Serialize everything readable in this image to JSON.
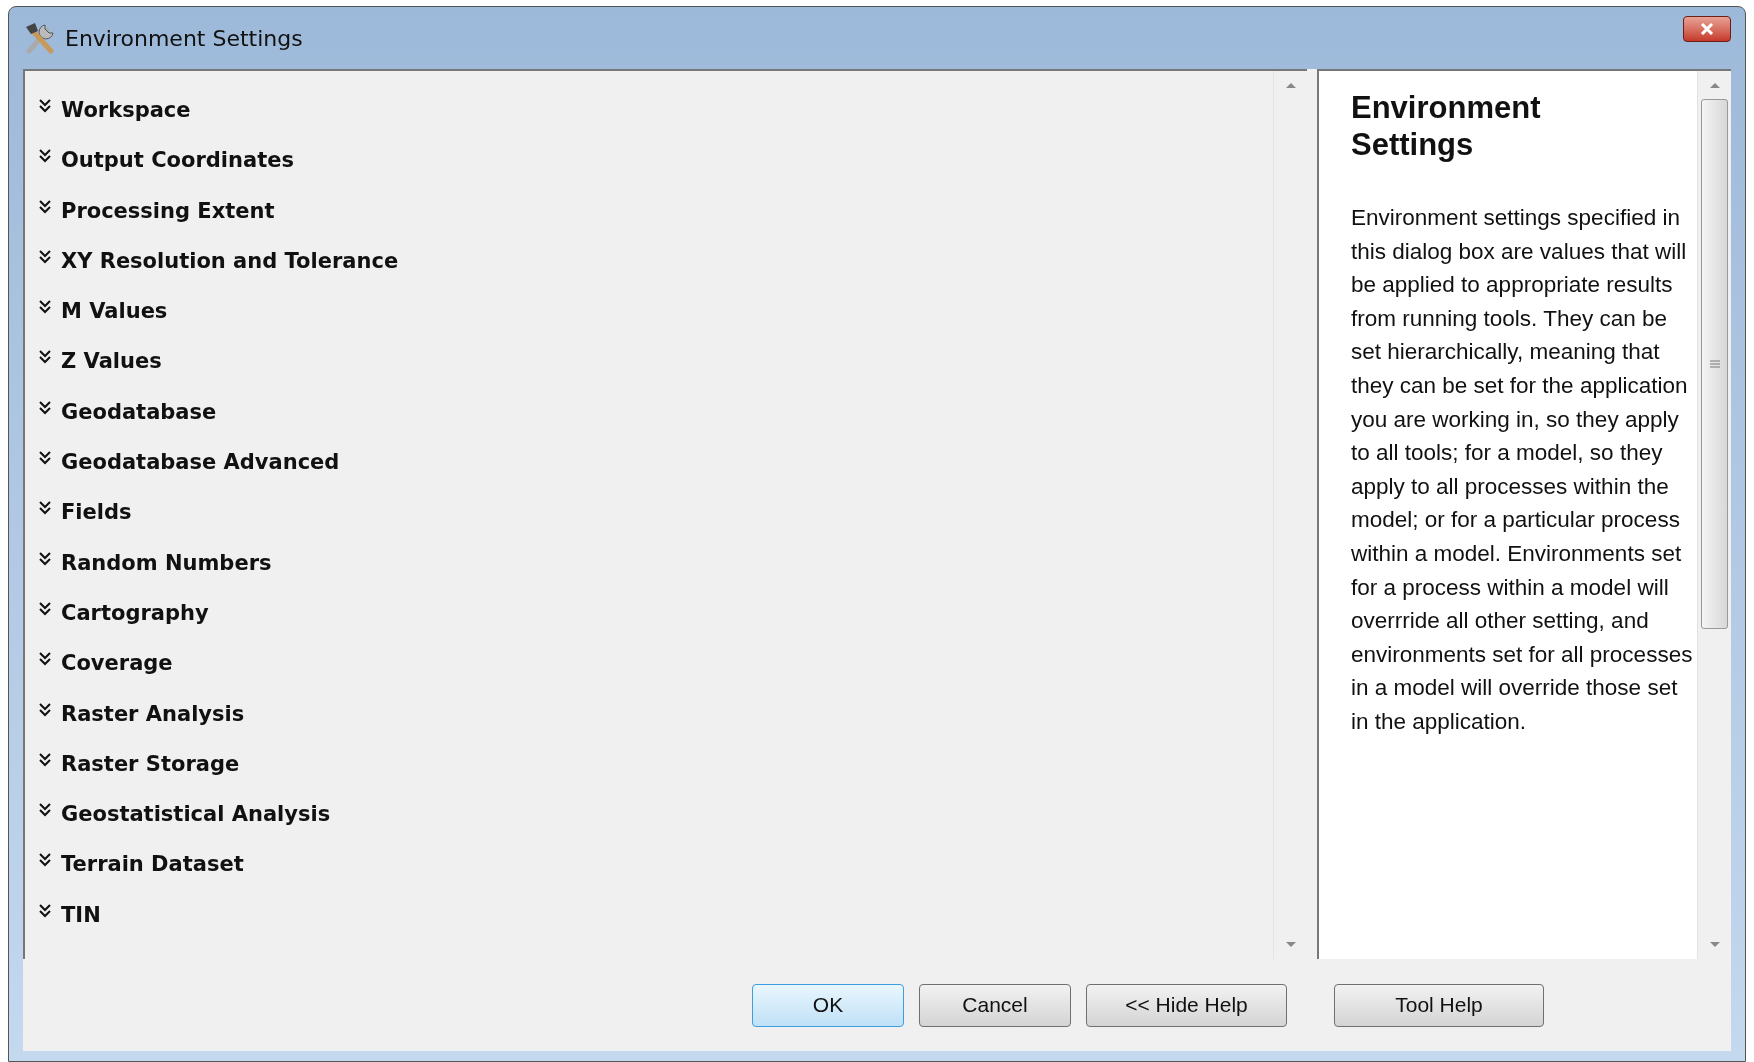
{
  "window": {
    "title": "Environment Settings"
  },
  "sections": [
    {
      "label": "Workspace",
      "expanded": false
    },
    {
      "label": "Output Coordinates",
      "expanded": false
    },
    {
      "label": "Processing Extent",
      "expanded": false
    },
    {
      "label": "XY Resolution and Tolerance",
      "expanded": false
    },
    {
      "label": "M Values",
      "expanded": false
    },
    {
      "label": "Z Values",
      "expanded": false
    },
    {
      "label": "Geodatabase",
      "expanded": false
    },
    {
      "label": "Geodatabase Advanced",
      "expanded": false
    },
    {
      "label": "Fields",
      "expanded": false
    },
    {
      "label": "Random Numbers",
      "expanded": false
    },
    {
      "label": "Cartography",
      "expanded": false
    },
    {
      "label": "Coverage",
      "expanded": false
    },
    {
      "label": "Raster Analysis",
      "expanded": false
    },
    {
      "label": "Raster Storage",
      "expanded": false
    },
    {
      "label": "Geostatistical Analysis",
      "expanded": false
    },
    {
      "label": "Terrain Dataset",
      "expanded": false
    },
    {
      "label": "TIN",
      "expanded": false
    }
  ],
  "help": {
    "title": "Environment Settings",
    "body": "Environment settings specified in this dialog box are values that will be applied to appropriate results from running tools. They can be set hierarchically, meaning that they can be set for the application you are working in, so they apply to all tools; for a model, so they apply to all processes within the model; or for a particular process within a model. Environments set for a process within a model will overrride all other setting, and environments set for all processes in a model will override those set in the application."
  },
  "buttons": [
    {
      "label": "OK",
      "default": true
    },
    {
      "label": "Cancel",
      "default": false
    },
    {
      "label": "<< Hide Help",
      "default": false
    },
    {
      "label": "Tool Help",
      "default": false
    }
  ]
}
